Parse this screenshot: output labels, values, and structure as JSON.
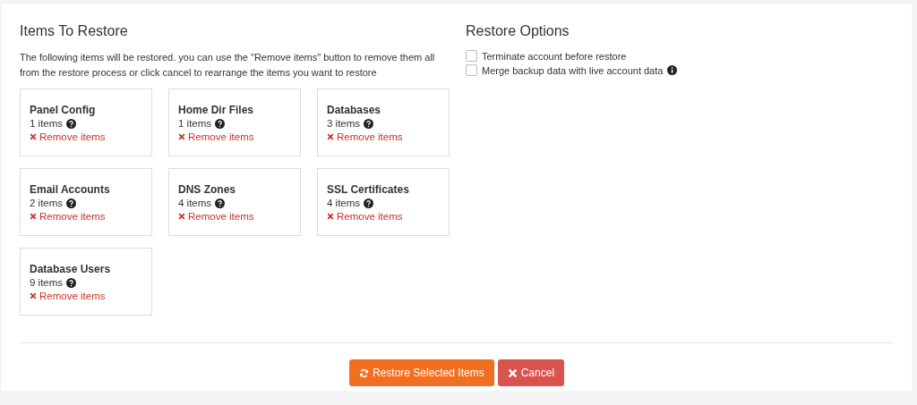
{
  "items_section": {
    "title": "Items To Restore",
    "description": "The following items will be restored. you can use the \"Remove items\" button to remove them all from the restore process or click cancel to rearrange the items you want to restore",
    "cards": [
      {
        "name": "Panel Config",
        "count": "1 items",
        "remove": "Remove items"
      },
      {
        "name": "Home Dir Files",
        "count": "1 items",
        "remove": "Remove items"
      },
      {
        "name": "Databases",
        "count": "3 items",
        "remove": "Remove items"
      },
      {
        "name": "Email Accounts",
        "count": "2 items",
        "remove": "Remove items"
      },
      {
        "name": "DNS Zones",
        "count": "4 items",
        "remove": "Remove items"
      },
      {
        "name": "SSL Certificates",
        "count": "4 items",
        "remove": "Remove items"
      },
      {
        "name": "Database Users",
        "count": "9 items",
        "remove": "Remove items"
      }
    ]
  },
  "options_section": {
    "title": "Restore Options",
    "options": [
      {
        "label": "Terminate account before restore",
        "checked": false,
        "info": false
      },
      {
        "label": "Merge backup data with live account data",
        "checked": false,
        "info": true
      }
    ]
  },
  "buttons": [
    {
      "kind": "primary",
      "label": "Restore Selected Items"
    },
    {
      "kind": "danger",
      "label": "Cancel"
    }
  ]
}
